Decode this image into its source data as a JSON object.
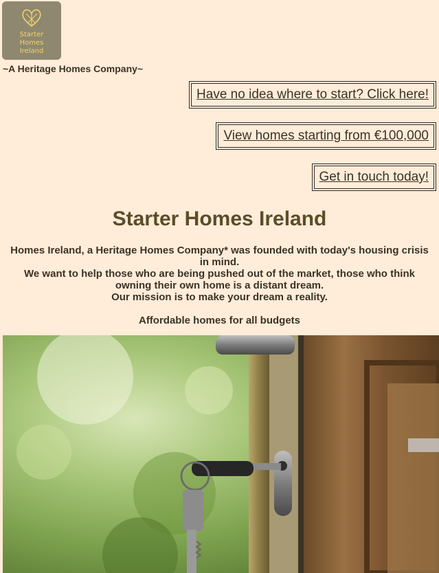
{
  "logo": {
    "lines": [
      "Starter",
      "Homes",
      "Ireland"
    ],
    "icon": "heart-knot-icon",
    "background": "#8f8870",
    "text_color": "#f1d36a"
  },
  "tagline": "~A Heritage Homes Company~",
  "ctas": [
    "Have no idea where to start? Click here!",
    "View homes starting from €100,000",
    "Get in touch today!"
  ],
  "title": "Starter Homes Ireland",
  "intro": {
    "lines": [
      "Homes Ireland, a Heritage Homes Company* was founded with today's housing crisis in mind.",
      "We want to help those who are being pushed out of the market, those who think owning their own home is a distant dream.",
      "Our mission is to make your dream a reality."
    ],
    "subheading": "Affordable homes for all budgets"
  },
  "hero": {
    "icon": "door-key-photo"
  },
  "colors": {
    "background": "#ffecd9",
    "title": "#5a4d28",
    "text": "#3a3326"
  }
}
